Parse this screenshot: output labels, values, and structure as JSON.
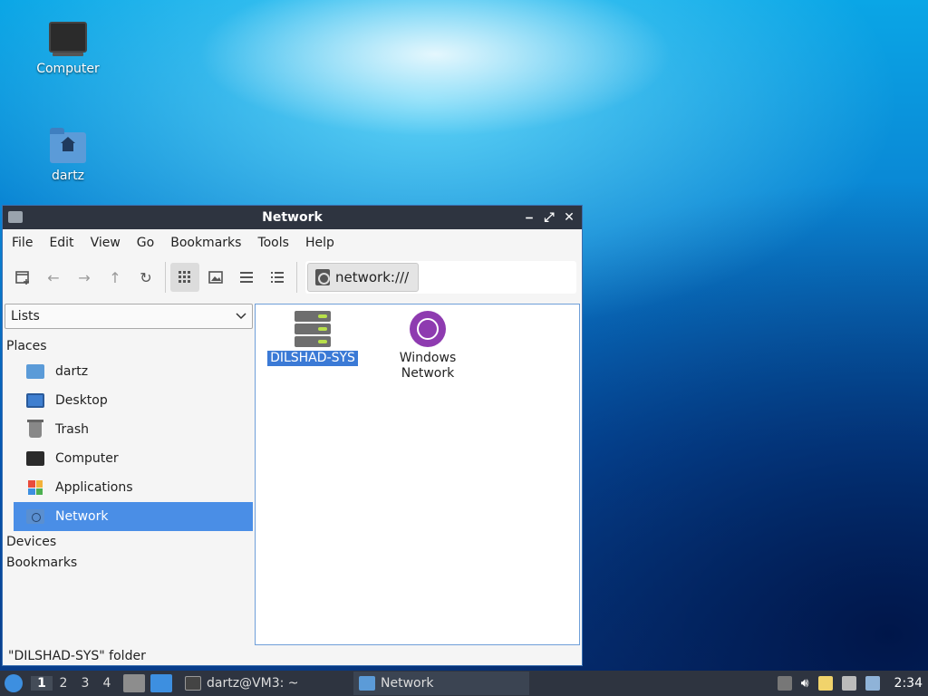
{
  "desktop": {
    "icons": [
      {
        "label": "Computer",
        "icon": "computer-icon"
      },
      {
        "label": "dartz",
        "icon": "home-folder-icon"
      }
    ]
  },
  "window": {
    "title": "Network",
    "controls": {
      "minimize": "⎯",
      "maximize": "⤢",
      "close": "✕"
    },
    "menu": [
      "File",
      "Edit",
      "View",
      "Go",
      "Bookmarks",
      "Tools",
      "Help"
    ],
    "toolbar": {
      "new_window_icon": "new-window-icon",
      "back_icon": "arrow-left-icon",
      "forward_icon": "arrow-right-icon",
      "up_icon": "arrow-up-icon",
      "reload_icon": "reload-icon",
      "icon_view": "grid-view-icon",
      "thumbnail_view": "thumbnail-view-icon",
      "compact_view": "compact-view-icon",
      "detailed_view": "list-view-icon",
      "location": "network:///"
    },
    "sidebar": {
      "mode": "Lists",
      "places_header": "Places",
      "places": [
        {
          "label": "dartz",
          "icon": "home-folder-icon"
        },
        {
          "label": "Desktop",
          "icon": "desktop-icon"
        },
        {
          "label": "Trash",
          "icon": "trash-icon"
        },
        {
          "label": "Computer",
          "icon": "computer-icon"
        },
        {
          "label": "Applications",
          "icon": "applications-icon"
        },
        {
          "label": "Network",
          "icon": "network-icon"
        }
      ],
      "devices_header": "Devices",
      "bookmarks_header": "Bookmarks"
    },
    "files": [
      {
        "label": "DILSHAD-SYS",
        "icon": "server-icon"
      },
      {
        "label": "Windows Network",
        "icon": "globe-icon"
      }
    ],
    "status": "\"DILSHAD-SYS\" folder"
  },
  "panel": {
    "workspaces": [
      "1",
      "2",
      "3",
      "4"
    ],
    "tasks": [
      {
        "label": "dartz@VM3: ~",
        "icon": "terminal-icon"
      },
      {
        "label": "Network",
        "icon": "folder-icon"
      }
    ],
    "clock": "2:34"
  },
  "colors": {
    "selection": "#3b7ad6",
    "sidebar_selection": "#4a8ee6",
    "titlebar": "#2e3440",
    "panel": "#2e3440"
  }
}
